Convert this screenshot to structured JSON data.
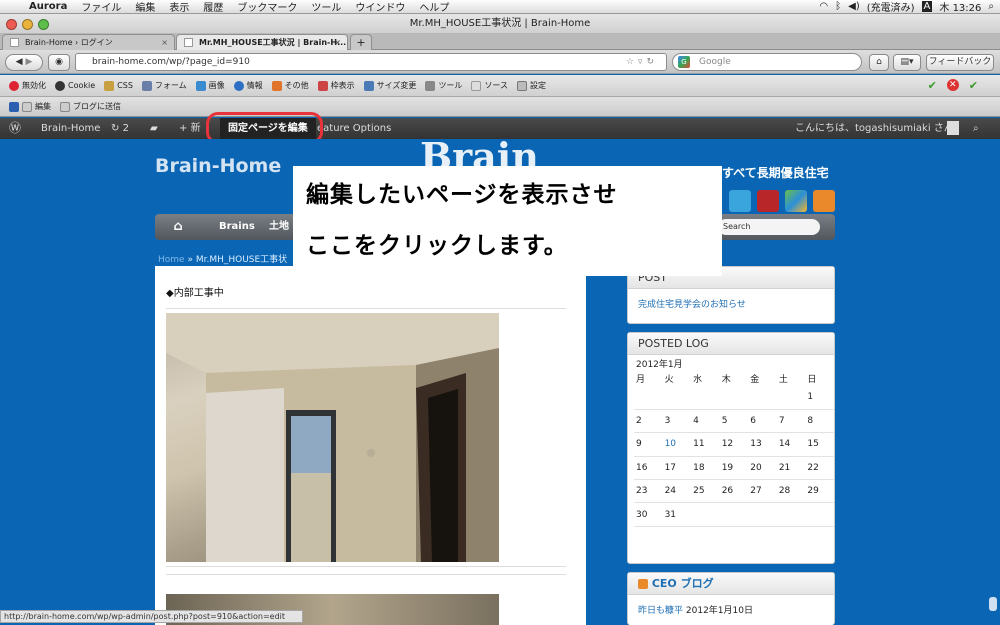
{
  "menubar": {
    "app": "Aurora",
    "items": [
      "ファイル",
      "編集",
      "表示",
      "履歴",
      "ブックマーク",
      "ツール",
      "ウインドウ",
      "ヘルプ"
    ],
    "battery": "(充電済み)",
    "input_indicator": "A",
    "clock": "木 13:26"
  },
  "window": {
    "title": "Mr.MH_HOUSE工事状況 | Brain-Home"
  },
  "tabs": [
    {
      "label": "Brain-Home › ログイン"
    },
    {
      "label": "Mr.MH_HOUSE工事状況 | Brain-H..."
    }
  ],
  "toolbar": {
    "url": "brain-home.com/wp/?page_id=910",
    "search_placeholder": "Google",
    "feedback_label": "フィードバック"
  },
  "devbar": {
    "items": [
      "無効化",
      "Cookie",
      "CSS",
      "フォーム",
      "画像",
      "情報",
      "その他",
      "枠表示",
      "サイズ変更",
      "ツール",
      "ソース",
      "設定"
    ]
  },
  "bookmarks": {
    "items": [
      "編集",
      "ブログに送信"
    ]
  },
  "adminbar": {
    "site_name": "Brain-Home",
    "updates_count": "2",
    "new_label": "新",
    "edit_page_label": "固定ページを編集",
    "feature_options_label": "eature Options",
    "greeting": "こんにちは、togashisumiaki さん！"
  },
  "site": {
    "title": "Brain-Home",
    "logo_text": "Brain",
    "tagline": "すべて長期優良住宅",
    "nav": [
      "Brains",
      "土地"
    ],
    "search_label": "Search",
    "breadcrumb_home": "Home",
    "breadcrumb_sep": " » ",
    "breadcrumb_current": "Mr.MH_HOUSE工事状"
  },
  "post": {
    "heading": "◆内部工事中"
  },
  "sidebar": {
    "post_widget": {
      "title": "POST",
      "link": "完成住宅見学会のお知らせ"
    },
    "calendar": {
      "title": "POSTED LOG",
      "caption": "2012年1月",
      "weekdays": [
        "月",
        "火",
        "水",
        "木",
        "金",
        "土",
        "日"
      ],
      "rows": [
        [
          "",
          "",
          "",
          "",
          "",
          "",
          "1"
        ],
        [
          "2",
          "3",
          "4",
          "5",
          "6",
          "7",
          "8"
        ],
        [
          "9",
          "10",
          "11",
          "12",
          "13",
          "14",
          "15"
        ],
        [
          "16",
          "17",
          "18",
          "19",
          "20",
          "21",
          "22"
        ],
        [
          "23",
          "24",
          "25",
          "26",
          "27",
          "28",
          "29"
        ],
        [
          "30",
          "31",
          "",
          "",
          "",
          "",
          ""
        ]
      ],
      "linked_day": "10"
    },
    "ceo_blog": {
      "title": "CEO ブログ",
      "entry_link": "昨日も糠平",
      "entry_date": "2012年1月10日"
    }
  },
  "annotation": {
    "line1": "編集したいページを表示させ",
    "line2": "ここをクリックします。",
    "color": "#e8333a"
  },
  "statusbar": {
    "text": "http://brain-home.com/wp/wp-admin/post.php?post=910&action=edit"
  }
}
